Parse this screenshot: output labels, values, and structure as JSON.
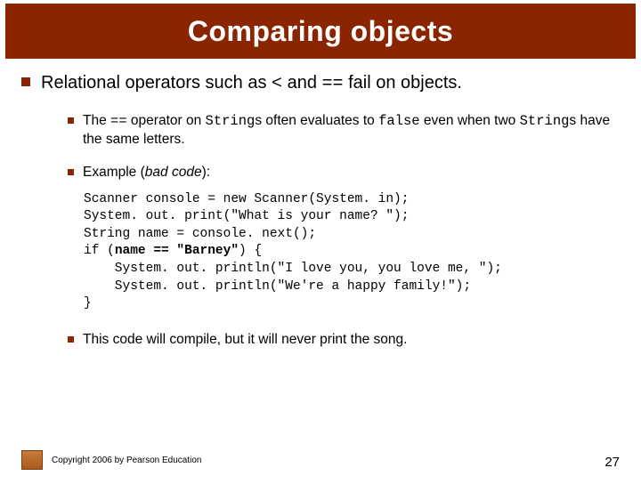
{
  "title": "Comparing objects",
  "main_point": {
    "before_code": "Relational operators such as ",
    "code1": "<",
    "mid": " and ",
    "code2": "==",
    "after_code": " fail on objects."
  },
  "sub1": {
    "p1": "The ",
    "c1": "==",
    "p2": " operator on ",
    "c2": "String",
    "p3": "s often evaluates to ",
    "c3": "false",
    "p4": " even when two ",
    "c4": "String",
    "p5": "s have the same letters."
  },
  "sub2": {
    "label": "Example (",
    "ital": "bad code",
    "tail": "):"
  },
  "code": {
    "l1": "Scanner console = new Scanner(System. in);",
    "l2": "System. out. print(\"What is your name? \");",
    "l3": "String name = console. next();",
    "l4a": "if (",
    "l4b": "name == \"Barney\"",
    "l4c": ") {",
    "l5": "    System. out. println(\"I love you, you love me, \");",
    "l6": "    System. out. println(\"We're a happy family!\");",
    "l7": "}"
  },
  "sub3": "This code will compile, but it will never print the song.",
  "copyright": "Copyright 2006 by Pearson Education",
  "page_number": "27"
}
